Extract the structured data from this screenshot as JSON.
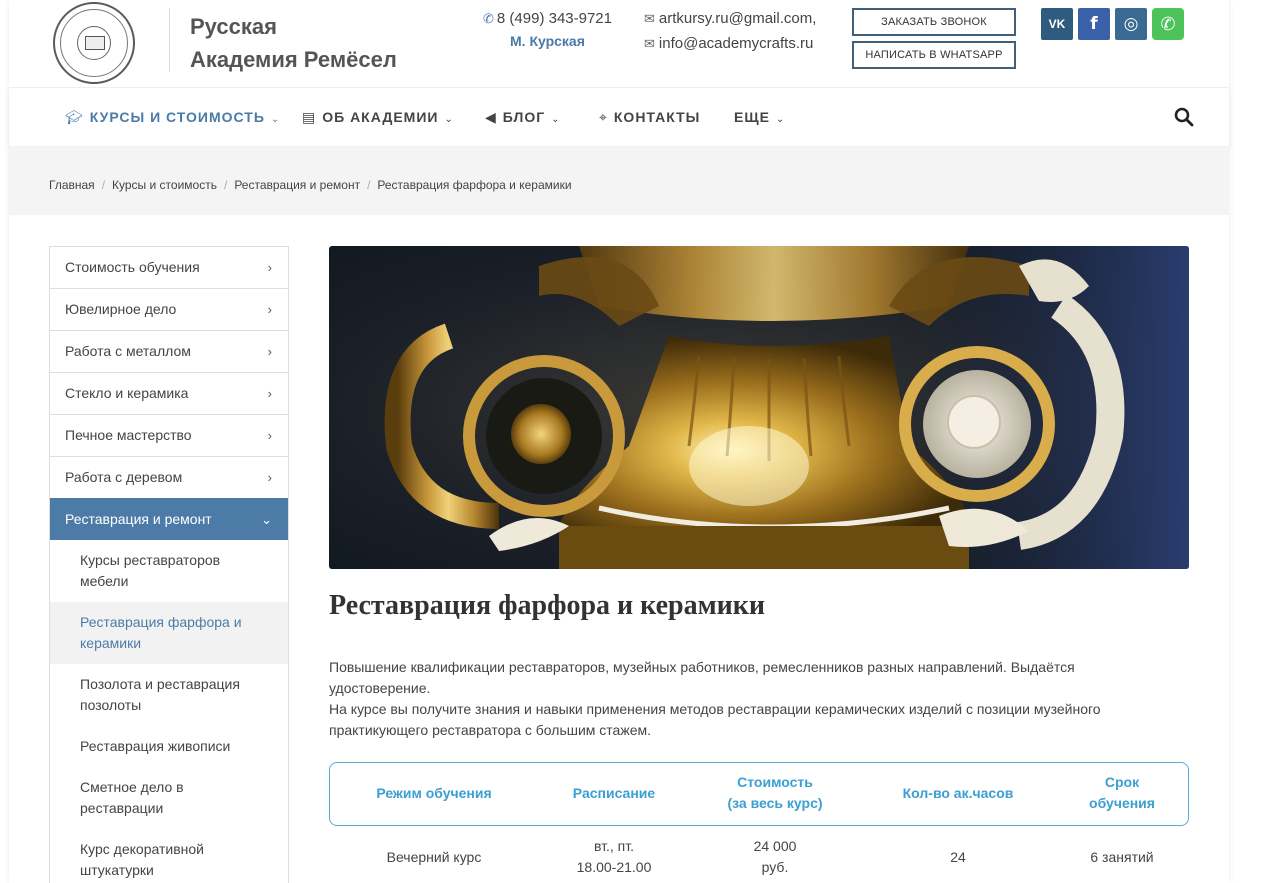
{
  "header": {
    "brand_line1": "Русская",
    "brand_line2": "Академия Ремёсел",
    "phone": "8 (499) 343-9721",
    "metro": "М. Курская",
    "email1": "artkursy.ru@gmail.com,",
    "email2": "info@academycrafts.ru",
    "call_button": "ЗАКАЗАТЬ ЗВОНОК",
    "whatsapp_button": "НАПИСАТЬ В WHATSAPP",
    "social": [
      {
        "name": "vk",
        "glyph": "VK",
        "color": "#2e5b7e"
      },
      {
        "name": "facebook",
        "glyph": "f",
        "color": "#3b62a8"
      },
      {
        "name": "instagram",
        "glyph": "◎",
        "color": "#3a6a92"
      },
      {
        "name": "whatsapp",
        "glyph": "✆",
        "color": "#4cc25a"
      }
    ]
  },
  "nav": {
    "items": [
      {
        "label": "КУРСЫ И СТОИМОСТЬ",
        "icon": "graduation-cap-icon",
        "has_dropdown": true,
        "active": true
      },
      {
        "label": "ОБ АКАДЕМИИ",
        "icon": "building-icon",
        "has_dropdown": true,
        "active": false
      },
      {
        "label": "БЛОГ",
        "icon": "megaphone-icon",
        "has_dropdown": true,
        "active": false
      },
      {
        "label": "КОНТАКТЫ",
        "icon": "map-pin-icon",
        "has_dropdown": false,
        "active": false
      },
      {
        "label": "ЕЩЕ",
        "icon": "",
        "has_dropdown": true,
        "active": false
      }
    ]
  },
  "breadcrumb": [
    "Главная",
    "Курсы и стоимость",
    "Реставрация и ремонт",
    "Реставрация фарфора и керамики"
  ],
  "sidebar": {
    "items": [
      "Стоимость обучения",
      "Ювелирное дело",
      "Работа с металлом",
      "Стекло и керамика",
      "Печное мастерство",
      "Работа с деревом",
      "Реставрация и ремонт"
    ],
    "sub_items": [
      "Курсы реставраторов мебели",
      "Реставрация фарфора и керамики",
      "Позолота и реставрация позолоты",
      "Реставрация живописи",
      "Сметное дело в реставрации",
      "Курс декоративной штукатурки"
    ]
  },
  "content": {
    "title": "Реставрация фарфора и керамики",
    "desc_line1": "Повышение квалификации реставраторов, музейных работников, ремесленников разных направлений. Выдаётся удостоверение.",
    "desc_line2": "На курсе вы получите знания и навыки применения методов реставрации керамических изделий с позиции музейного практикующего реставратора с большим стажем."
  },
  "table": {
    "headers": [
      "Режим обучения",
      "Расписание",
      "Стоимость\n(за весь курс)",
      "Кол-во ак.часов",
      "Срок\nобучения"
    ],
    "row": [
      "Вечерний курс",
      "вт., пт.\n18.00-21.00",
      "24 000\nруб.",
      "24",
      "6 занятий"
    ]
  },
  "colors": {
    "accent": "#4a7aa8",
    "table_accent": "#3a9fd1",
    "sidebar_open": "#4d7ba7"
  }
}
